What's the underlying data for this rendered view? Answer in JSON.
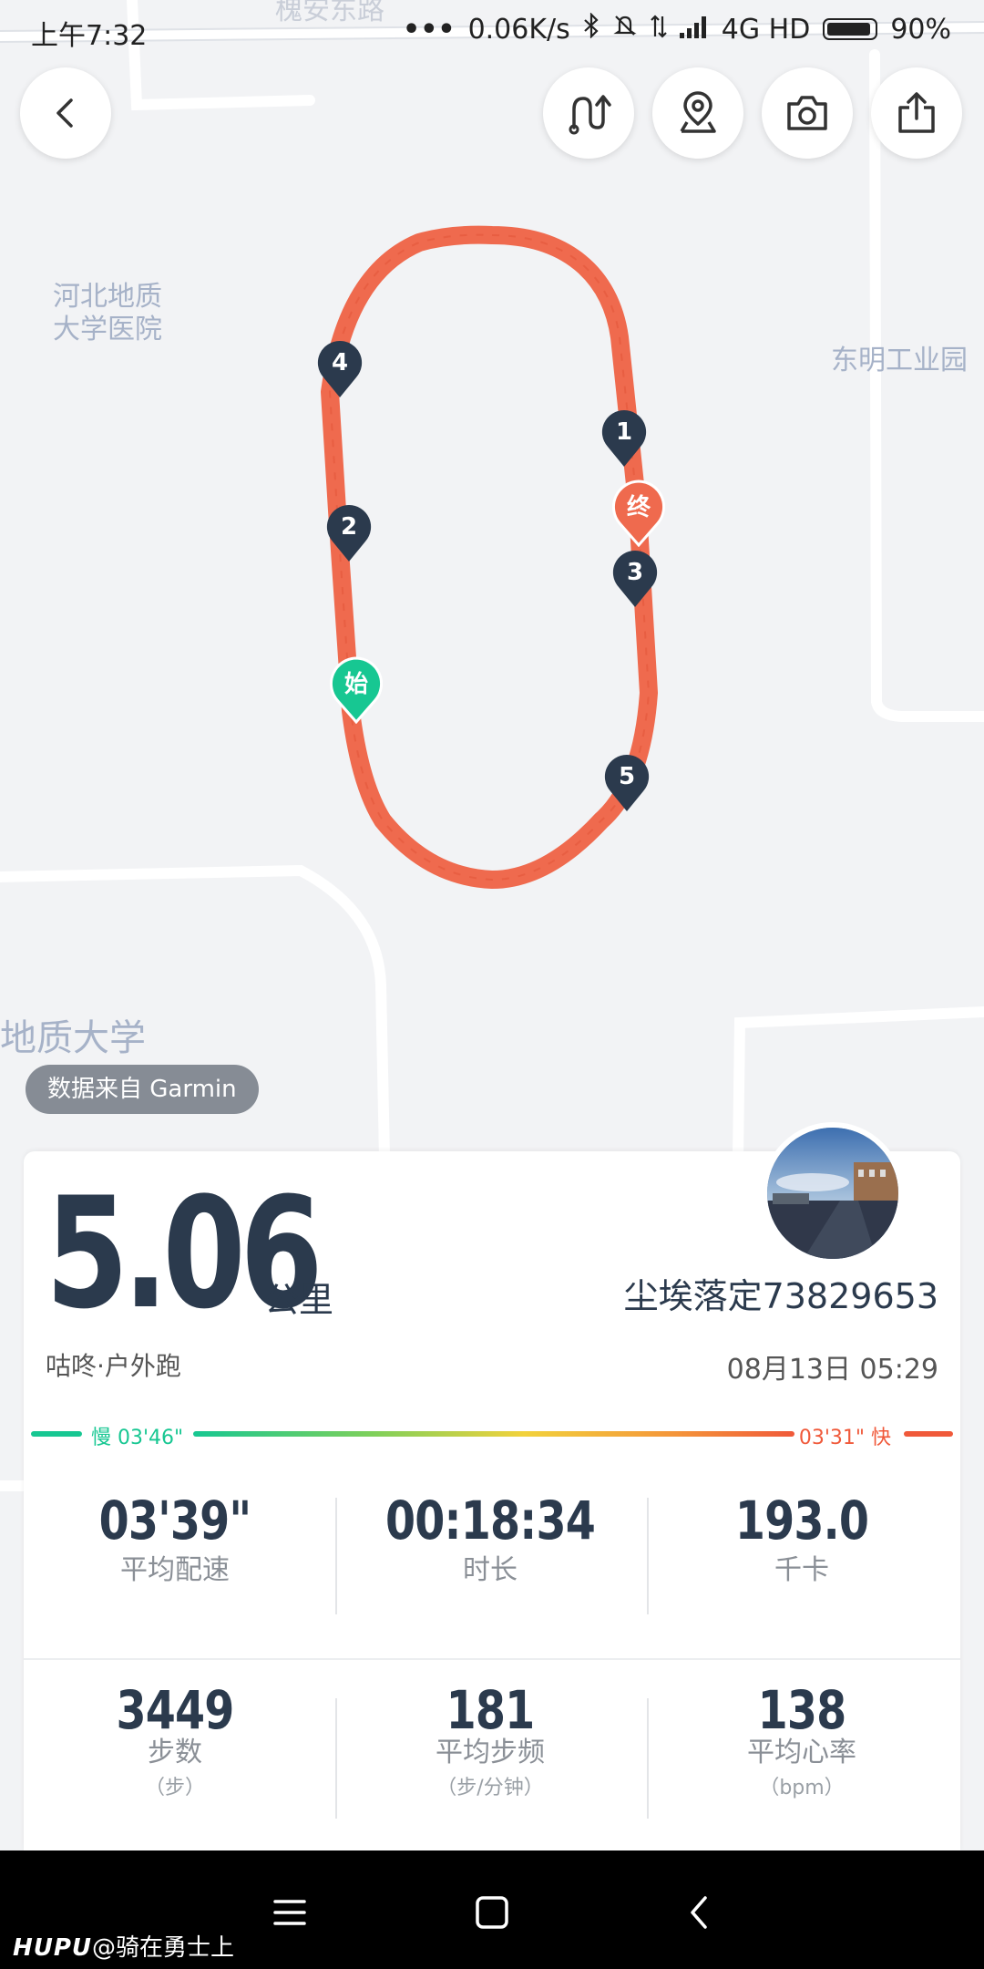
{
  "status_bar": {
    "time": "上午7:32",
    "network_speed": "0.06K/s",
    "network_type": "4G HD",
    "battery": "90%"
  },
  "map": {
    "labels": {
      "road_top": "槐安东路",
      "hospital": "河北地质\n大学医院",
      "industrial_park": "东明工业园",
      "university": "地质大学"
    },
    "split_markers": [
      "1",
      "2",
      "3",
      "4",
      "5"
    ],
    "start_marker": "始",
    "end_marker": "终",
    "route_color": "#ef6a4e"
  },
  "toolbar": {
    "icons": [
      "back-icon",
      "route-replay-icon",
      "location-pin-icon",
      "camera-icon",
      "share-icon"
    ]
  },
  "data_source": "数据来自 Garmin",
  "summary": {
    "distance": "5.06",
    "distance_unit": "公里",
    "username": "尘埃落定73829653",
    "activity_type": "咕咚·户外跑",
    "date": "08月13日 05:29"
  },
  "pace_bar": {
    "slow_label": "慢 03'46\"",
    "fast_label": "03'31\" 快",
    "slow_color": "#17c792",
    "fast_color": "#f0593a"
  },
  "stats": [
    {
      "value": "03'39\"",
      "label": "平均配速",
      "sub": ""
    },
    {
      "value": "00:18:34",
      "label": "时长",
      "sub": ""
    },
    {
      "value": "193.0",
      "label": "千卡",
      "sub": ""
    },
    {
      "value": "3449",
      "label": "步数",
      "sub": "（步）"
    },
    {
      "value": "181",
      "label": "平均步频",
      "sub": "（步/分钟）"
    },
    {
      "value": "138",
      "label": "平均心率",
      "sub": "（bpm）"
    }
  ],
  "watermark": {
    "brand": "HUPU",
    "handle": "@骑在勇士上"
  }
}
